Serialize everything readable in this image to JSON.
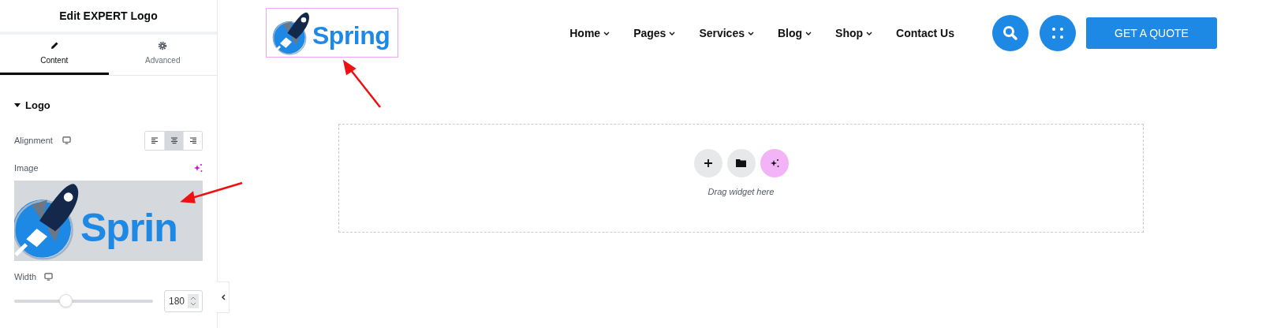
{
  "panel": {
    "title": "Edit EXPERT Logo",
    "tabs": [
      {
        "label": "Content",
        "selected": true
      },
      {
        "label": "Advanced",
        "selected": false
      }
    ],
    "section": {
      "title": "Logo",
      "expanded": true
    },
    "alignment": {
      "label": "Alignment",
      "options": [
        {
          "kind": "left",
          "selected": false
        },
        {
          "kind": "center",
          "selected": true
        },
        {
          "kind": "right",
          "selected": false
        }
      ]
    },
    "image": {
      "label": "Image",
      "preview_text": "Sprin"
    },
    "width": {
      "label": "Width",
      "level": 0.36,
      "value": "180"
    }
  },
  "header": {
    "logo_text": "Spring",
    "nav": [
      {
        "label": "Home",
        "dropdown": true
      },
      {
        "label": "Pages",
        "dropdown": true
      },
      {
        "label": "Services",
        "dropdown": true
      },
      {
        "label": "Blog",
        "dropdown": true
      },
      {
        "label": "Shop",
        "dropdown": true
      },
      {
        "label": "Contact Us",
        "dropdown": false
      }
    ],
    "cta": "GET A QUOTE"
  },
  "drop_area": {
    "hint": "Drag widget here"
  }
}
